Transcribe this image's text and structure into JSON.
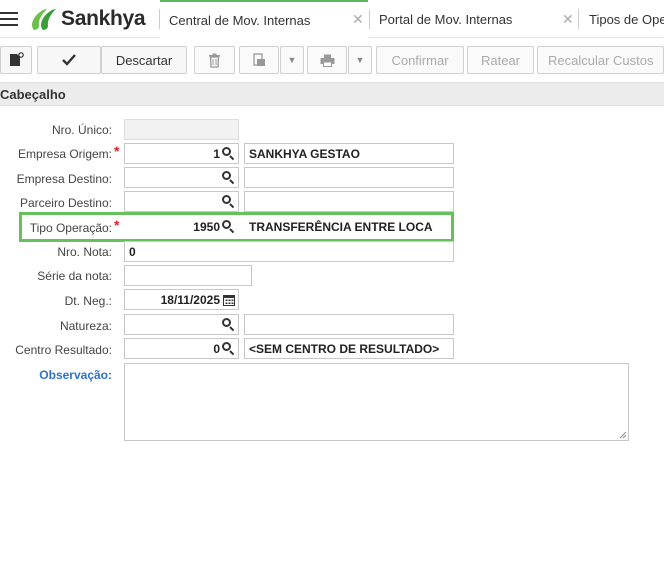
{
  "app": {
    "brand": "Sankhya"
  },
  "tabs": [
    {
      "label": "Central de Mov. Internas",
      "active": true
    },
    {
      "label": "Portal de Mov. Internas",
      "active": false
    },
    {
      "label": "Tipos de Ope",
      "active": false
    }
  ],
  "toolbar": {
    "discard_label": "Descartar",
    "confirm_label": "Confirmar",
    "ratear_label": "Ratear",
    "recalc_label": "Recalcular Custos"
  },
  "section": {
    "title": "Cabeçalho"
  },
  "form": {
    "nro_unico": {
      "label": "Nro. Único:",
      "value": ""
    },
    "empresa_origem": {
      "label": "Empresa Origem:",
      "code": "1",
      "name": "SANKHYA GESTAO"
    },
    "empresa_destino": {
      "label": "Empresa Destino:",
      "code": "",
      "name": ""
    },
    "parceiro_destino": {
      "label": "Parceiro Destino:",
      "code": "",
      "name": ""
    },
    "tipo_operacao": {
      "label": "Tipo Operação:",
      "code": "1950",
      "name": "TRANSFERÊNCIA ENTRE LOCA"
    },
    "nro_nota": {
      "label": "Nro. Nota:",
      "value": "0"
    },
    "serie_nota": {
      "label": "Série da nota:",
      "value": ""
    },
    "dt_neg": {
      "label": "Dt. Neg.:",
      "value": "18/11/2025"
    },
    "natureza": {
      "label": "Natureza:",
      "code": "",
      "name": ""
    },
    "centro_resultado": {
      "label": "Centro Resultado:",
      "code": "0",
      "name": "<SEM CENTRO DE RESULTADO>"
    },
    "observacao": {
      "label": "Observação:",
      "value": ""
    }
  },
  "colors": {
    "accent": "#5bb561",
    "highlight": "#66c05c",
    "required": "#d9232d",
    "link": "#2f72c9"
  }
}
